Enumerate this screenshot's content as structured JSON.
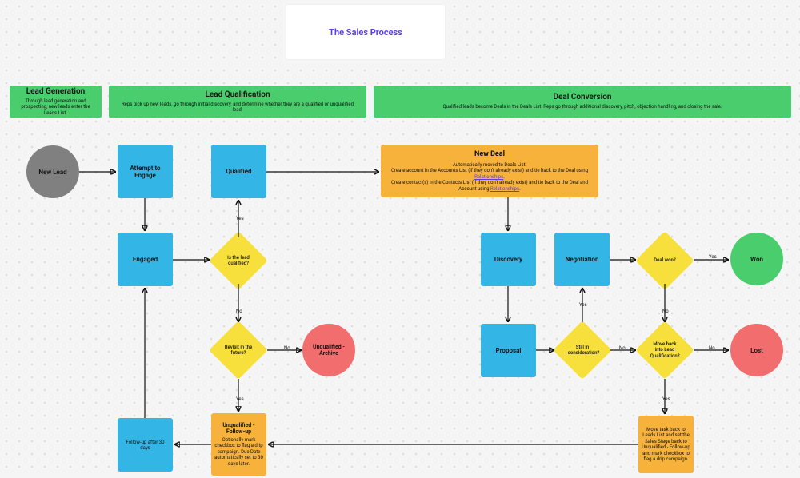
{
  "title": "The Sales Process",
  "phases": {
    "lead_gen": {
      "title": "Lead Generation",
      "desc": "Through lead generation and prospecting, new leads enter the Leads List."
    },
    "lead_qual": {
      "title": "Lead Qualification",
      "desc": "Reps pick up new leads, go through initial discovery, and determine whether they are a qualified or unqualified lead."
    },
    "deal_conv": {
      "title": "Deal Conversion",
      "desc": "Qualified leads become Deals in the Deals List. Reps go through additional discovery, pitch, objection handling, and closing the sale."
    }
  },
  "nodes": {
    "new_lead": "New Lead",
    "attempt": "Attempt to Engage",
    "engaged": "Engaged",
    "qualified": "Qualified",
    "followup30": "Follow-up after 30 days",
    "unq_followup_title": "Unqualified - Follow-up",
    "unq_followup_desc": "Optionally mark checkbox to flag a drip campaign. Due Date automatically set to 30 days later.",
    "unq_archive": "Unqualified - Archive",
    "new_deal_title": "New Deal",
    "new_deal_line1": "Automatically moved to Deals List.",
    "new_deal_line2a": "Create account in the Accounts List (if they don't already exist) and tie back to the Deal using ",
    "new_deal_link1": "Relationships",
    "new_deal_line2b": ".",
    "new_deal_line3a": "Create contact(s) in the Contacts List (if they don't already exist) and tie back to the Deal and Account using ",
    "new_deal_link2": "Relationships",
    "new_deal_line3b": ".",
    "discovery": "Discovery",
    "proposal": "Proposal",
    "negotiation": "Negotiation",
    "won": "Won",
    "lost": "Lost",
    "move_back_desc": "Move task back to Leads List and set the Sales Stage back to Unqualified - Follow-up and mark checkbox to flag a drip campaign."
  },
  "decisions": {
    "is_qualified": "Is the lead qualified?",
    "revisit": "Revisit in the future?",
    "still": "Still in consideration?",
    "deal_won": "Deal won?",
    "move_back": "Move back into Lead Qualification?"
  },
  "labels": {
    "yes": "Yes",
    "no": "No"
  }
}
